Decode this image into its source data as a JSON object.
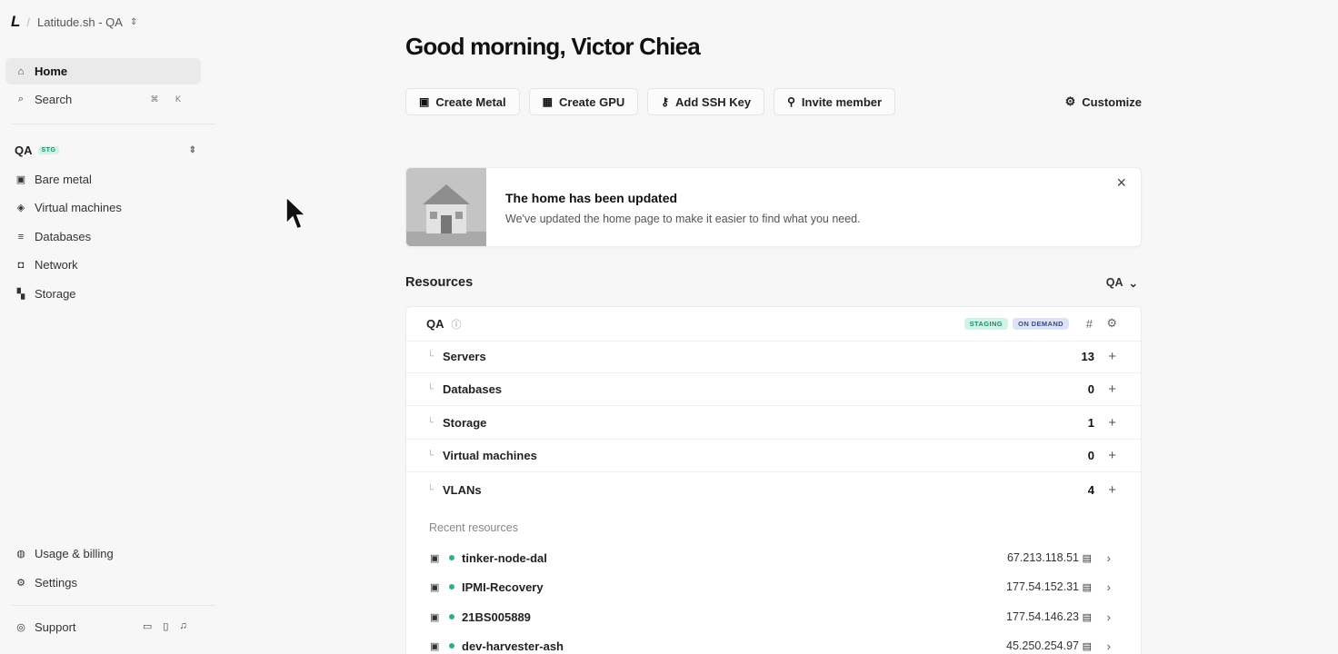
{
  "header": {
    "logo": "L",
    "workspace": "Latitude.sh - QA"
  },
  "sidebar": {
    "home": "Home",
    "search": "Search",
    "search_shortcut": "⌘ K",
    "project_name": "QA",
    "project_badge": "STG",
    "items": [
      {
        "label": "Bare metal",
        "icon": "server-icon"
      },
      {
        "label": "Virtual machines",
        "icon": "layers-icon"
      },
      {
        "label": "Databases",
        "icon": "database-icon"
      },
      {
        "label": "Network",
        "icon": "network-icon"
      },
      {
        "label": "Storage",
        "icon": "storage-icon"
      }
    ],
    "usage": "Usage & billing",
    "settings": "Settings",
    "support": "Support"
  },
  "main": {
    "greeting": "Good morning, Victor Chiea",
    "actions": [
      "Create Metal",
      "Create GPU",
      "Add SSH Key",
      "Invite member"
    ],
    "customize": "Customize",
    "banner": {
      "title": "The home has been updated",
      "text": "We've updated the home page to make it easier to find what you need."
    },
    "resources_title": "Resources",
    "resources_filter": "QA",
    "card": {
      "project": "QA",
      "tag_staging": "STAGING",
      "tag_on_demand": "ON DEMAND",
      "rows": [
        {
          "label": "Servers",
          "count": "13"
        },
        {
          "label": "Databases",
          "count": "0"
        },
        {
          "label": "Storage",
          "count": "1"
        },
        {
          "label": "Virtual machines",
          "count": "0"
        },
        {
          "label": "VLANs",
          "count": "4"
        }
      ],
      "recent_label": "Recent resources",
      "recent": [
        {
          "name": "tinker-node-dal",
          "ip": "67.213.118.51"
        },
        {
          "name": "IPMI-Recovery",
          "ip": "177.54.152.31"
        },
        {
          "name": "21BS005889",
          "ip": "177.54.146.23"
        },
        {
          "name": "dev-harvester-ash",
          "ip": "45.250.254.97"
        }
      ]
    }
  },
  "colors": {
    "status_green": "#2db37a",
    "staging_bg": "#d4f1e6",
    "on_demand_bg": "#dde3f5"
  }
}
